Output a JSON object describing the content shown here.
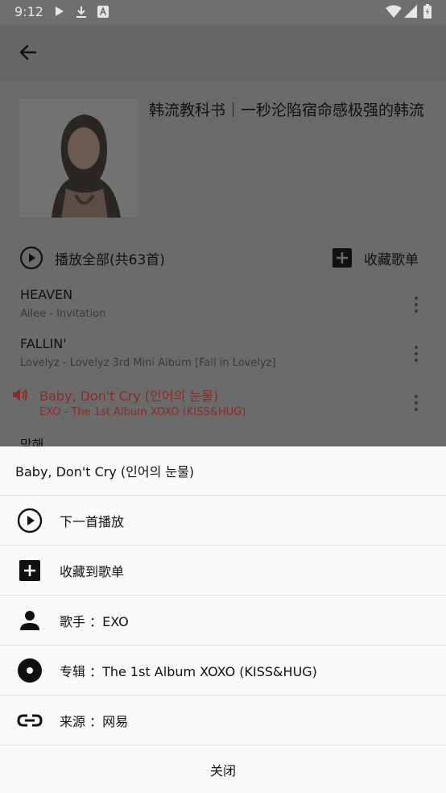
{
  "status_bar": {
    "time": "9:12",
    "icons": [
      "play-icon",
      "download-icon",
      "a-icon",
      "wifi-icon",
      "signal-icon",
      "battery-icon"
    ]
  },
  "playlist": {
    "title": "韩流教科书｜一秒沦陷宿命感极强的韩流",
    "play_all_label": "播放全部(共63首)",
    "collect_label": "收藏歌单"
  },
  "songs": [
    {
      "title": "HEAVEN",
      "subtitle": "Ailee - Invitation",
      "playing": false
    },
    {
      "title": "FALLIN'",
      "subtitle": "Lovelyz - Lovelyz 3rd Mini Album [Fall in Lovelyz]",
      "playing": false
    },
    {
      "title": "Baby, Don't Cry (인어의 눈물)",
      "subtitle": "EXO - The 1st Album XOXO (KISS&HUG)",
      "playing": true
    },
    {
      "title": "막해",
      "subtitle": "",
      "playing": false
    }
  ],
  "sheet": {
    "header": "Baby, Don't Cry (인어의 눈물)",
    "items": [
      {
        "label": "下一首播放",
        "icon": "play-next-icon"
      },
      {
        "label": "收藏到歌单",
        "icon": "add-box-icon"
      },
      {
        "label": "歌手 ：EXO",
        "icon": "person-icon"
      },
      {
        "label": "专辑 ：The 1st Album XOXO (KISS&HUG)",
        "icon": "album-disc-icon"
      },
      {
        "label": "来源 ：网易",
        "icon": "link-icon"
      }
    ],
    "close_label": "关闭"
  },
  "colors": {
    "playing_accent": "#8a2b2b",
    "overlay": "#6b6b6b",
    "sheet_bg": "#fafafa"
  }
}
